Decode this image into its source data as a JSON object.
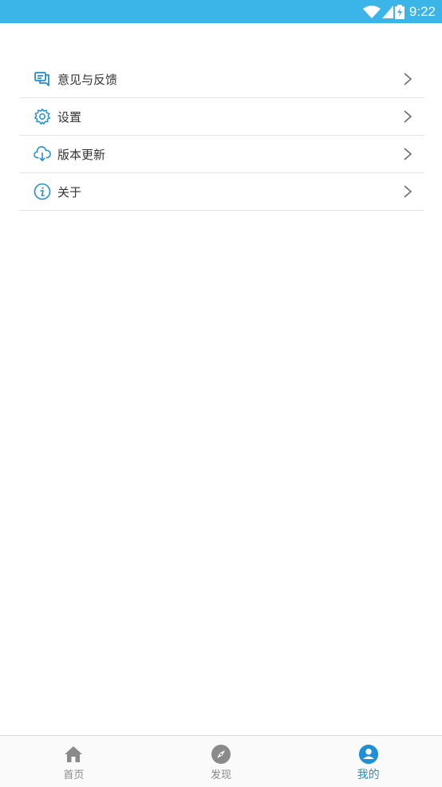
{
  "status_bar": {
    "time": "9:22",
    "bg_color": "#3bb5e8"
  },
  "menu": {
    "items": [
      {
        "label": "意见与反馈",
        "icon": "feedback-icon"
      },
      {
        "label": "设置",
        "icon": "gear-icon"
      },
      {
        "label": "版本更新",
        "icon": "download-icon"
      },
      {
        "label": "关于",
        "icon": "info-icon"
      }
    ],
    "accent_color": "#1f8fd8"
  },
  "tabbar": {
    "tabs": [
      {
        "label": "首页",
        "icon": "home-icon",
        "active": false
      },
      {
        "label": "发现",
        "icon": "compass-icon",
        "active": false
      },
      {
        "label": "我的",
        "icon": "user-icon",
        "active": true
      }
    ],
    "active_color": "#1f8fd8",
    "inactive_color": "#8a8a8a"
  }
}
